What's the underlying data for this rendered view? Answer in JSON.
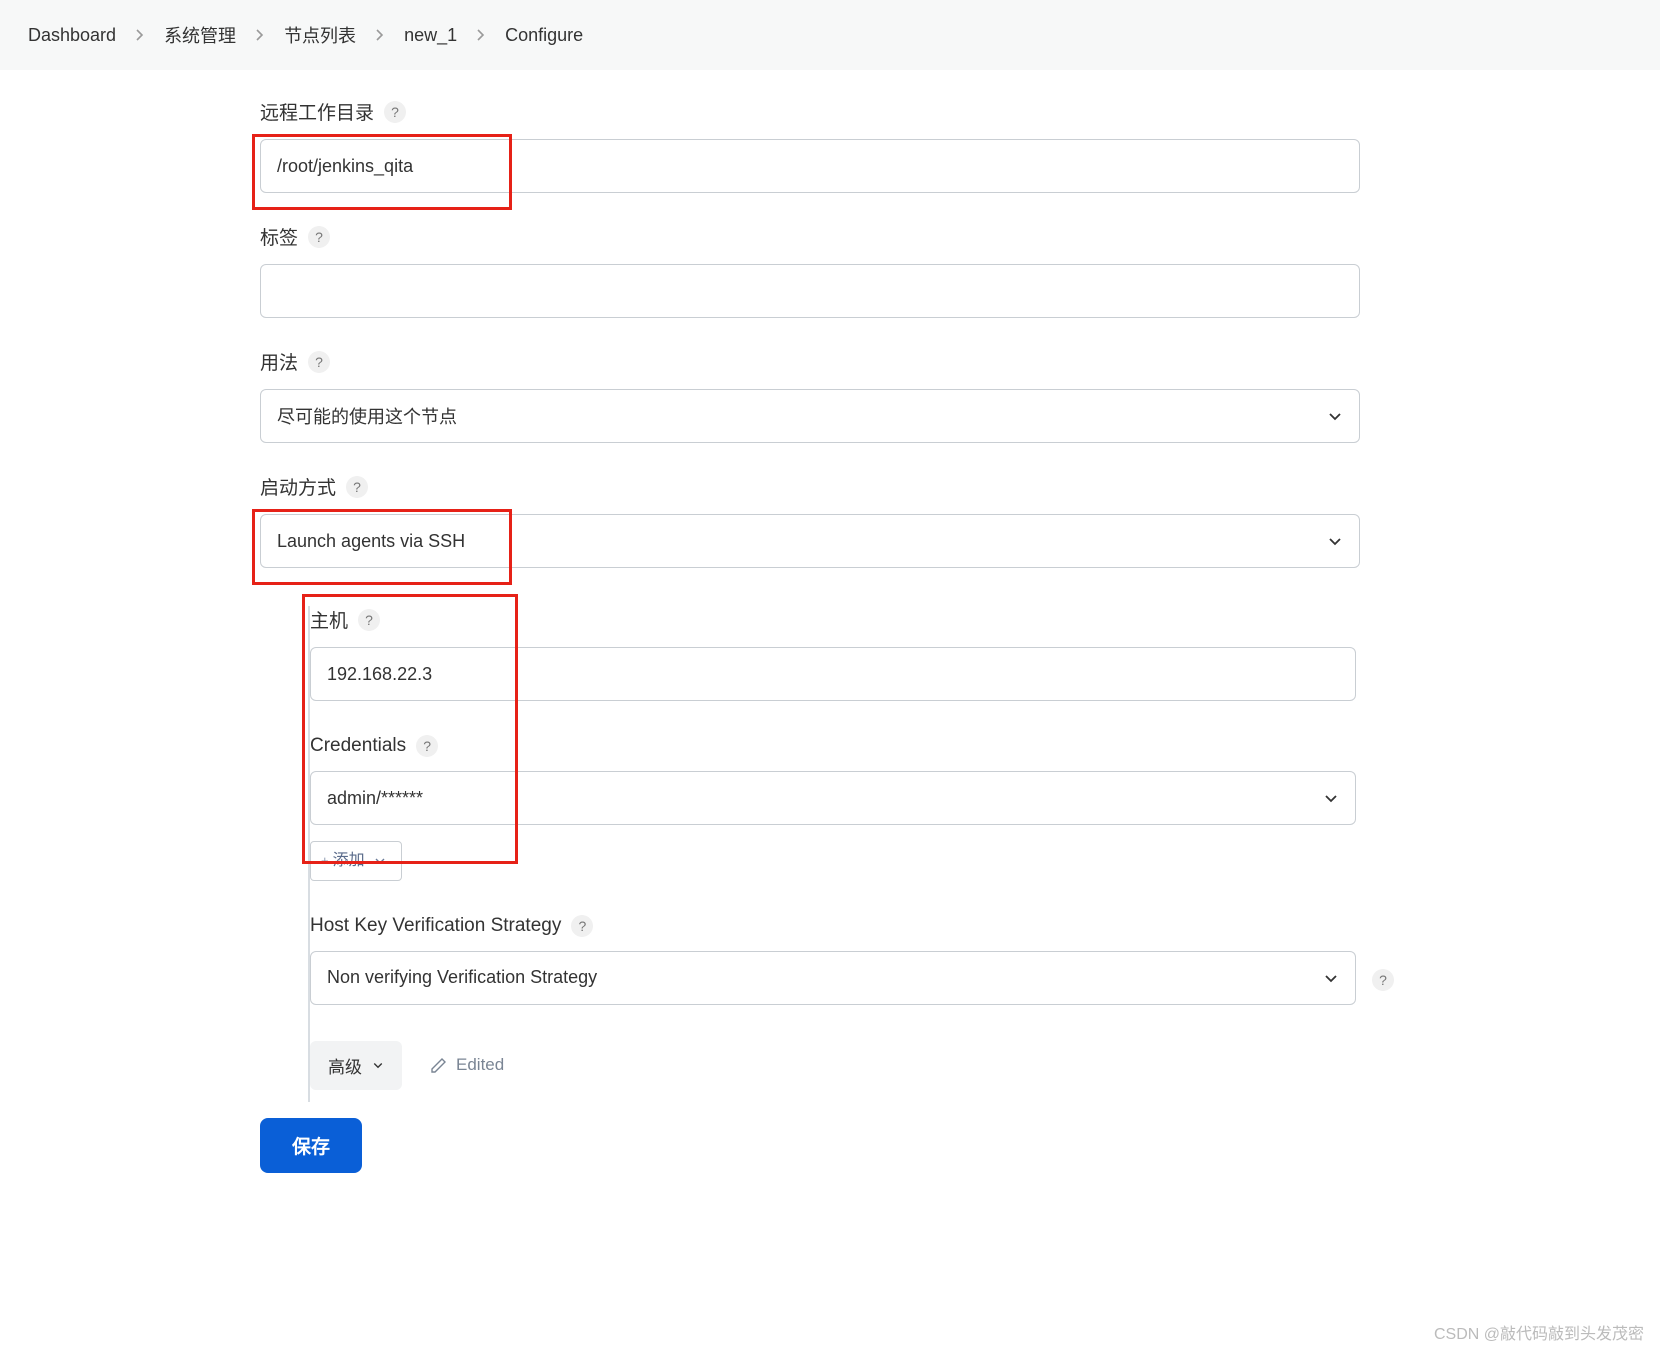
{
  "breadcrumb": {
    "items": [
      {
        "label": "Dashboard"
      },
      {
        "label": "系统管理"
      },
      {
        "label": "节点列表"
      },
      {
        "label": "new_1"
      },
      {
        "label": "Configure"
      }
    ]
  },
  "form": {
    "remote_dir": {
      "label": "远程工作目录",
      "value": "/root/jenkins_qita"
    },
    "labels": {
      "label": "标签",
      "value": ""
    },
    "usage": {
      "label": "用法",
      "selected": "尽可能的使用这个节点"
    },
    "launch": {
      "label": "启动方式",
      "selected": "Launch agents via SSH"
    },
    "ssh": {
      "host": {
        "label": "主机",
        "value": "192.168.22.3"
      },
      "credentials": {
        "label": "Credentials",
        "selected": "admin/******",
        "add_label": "添加"
      },
      "host_key": {
        "label": "Host Key Verification Strategy",
        "selected": "Non verifying Verification Strategy"
      },
      "advanced_label": "高级",
      "edited_label": "Edited"
    },
    "save_label": "保存"
  },
  "watermark": "CSDN @敲代码敲到头发茂密",
  "icons": {
    "help": "?"
  }
}
